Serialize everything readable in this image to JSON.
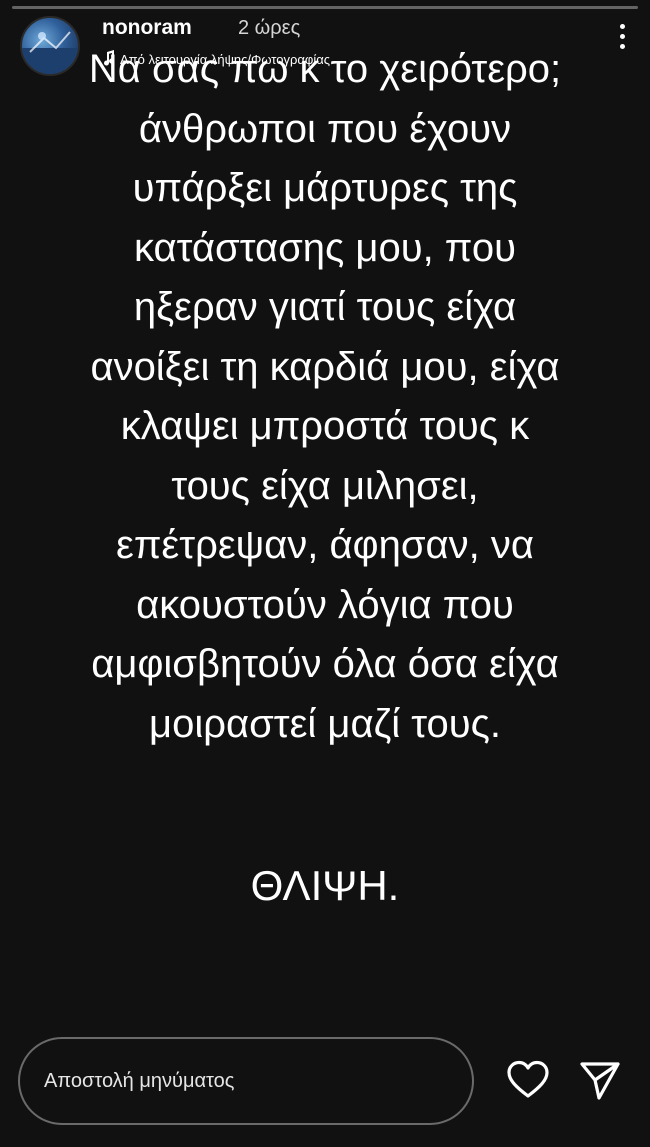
{
  "story": {
    "progress_fraction": 0
  },
  "header": {
    "username": "nonoram",
    "timestamp": "2 ώρες",
    "music_label": "Από λειτουργία λήψης/Φωτογραφίας",
    "avatar_icon": "avatar-image",
    "more_icon": "more-options-icon"
  },
  "content": {
    "lines": [
      "Να σας πω κ το χειρότερο;",
      "άνθρωποι που έχουν",
      "υπάρξει μάρτυρες της",
      "κατάστασης μου, που",
      "ηξεραν γιατί τους είχα",
      "ανοίξει τη καρδιά μου, είχα",
      "κλαψει μπροστά τους κ",
      "τους είχα μιλησει,",
      "επέτρεψαν, άφησαν, να",
      "ακουστούν λόγια που",
      "αμφισβητούν όλα όσα είχα",
      "μοιραστεί μαζί τους."
    ],
    "title": "ΘΛΙΨΗ."
  },
  "footer": {
    "reply_placeholder": "Αποστολή μηνύματος",
    "like_icon": "heart-icon",
    "send_icon": "send-icon"
  },
  "colors": {
    "background": "#111111",
    "text": "#ffffff",
    "input_border": "#6a6a6a"
  }
}
